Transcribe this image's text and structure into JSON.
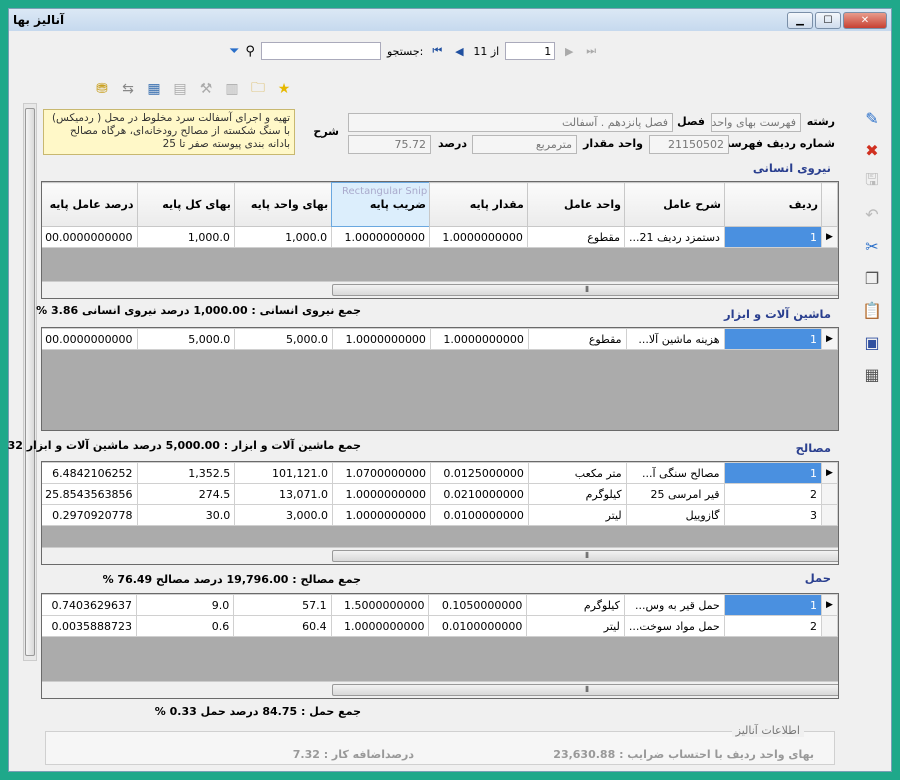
{
  "window": {
    "title": "آنالیز بها"
  },
  "nav": {
    "search_label": "جستجو:",
    "of_label": "از 11",
    "position": "1"
  },
  "header": {
    "reshteh_label": "رشته",
    "reshteh_value": "فهرست بهای واحد پا",
    "fasl_label": "فصل",
    "fasl_value": "فصل پانزدهم . آسفالت",
    "radif_label": "شماره ردیف فهرست",
    "radif_value": "21150502",
    "unit_label": "واحد مقدار",
    "unit_value": "مترمربع",
    "percent_label": "درصد",
    "percent_value": "75.72",
    "sharh_label": "شرح",
    "sharh_value": "تهیه و اجرای آسفالت سرد مخلوط در محل ( ردمیکس) با سنگ شکسته از مصالح رودخانه‌ای، هرگاه مصالح بادانه بندی پیوسته صفر تا 25"
  },
  "columns": [
    "ردیف",
    "شرح عامل",
    "واحد عامل",
    "مقدار پایه",
    "ضریب پایه",
    "بهای واحد پایه",
    "بهای کل پایه",
    "درصد عامل پایه"
  ],
  "sections": [
    {
      "title": "نیروی انسانی",
      "rows": [
        [
          "1",
          "دستمزد ردیف 21...",
          "مقطوع",
          "1.0000000000",
          "1.0000000000",
          "1,000.0",
          "1,000.0",
          "00.0000000000"
        ]
      ],
      "total": "جمع نیروی انسانی : 1,000.00  درصد نیروی انسانی 3.86 %"
    },
    {
      "title": "ماشین آلات و ابزار",
      "rows": [
        [
          "1",
          "هزینه ماشین آلا...",
          "مقطوع",
          "1.0000000000",
          "1.0000000000",
          "5,000.0",
          "5,000.0",
          "00.0000000000"
        ]
      ],
      "total": "جمع ماشین آلات و ابزار : 5,000.00  درصد ماشین آلات و ابزار 32"
    },
    {
      "title": "مصالح",
      "rows": [
        [
          "1",
          "مصالح سنگی آ...",
          "متر مکعب",
          "0.0125000000",
          "1.0700000000",
          "101,121.0",
          "1,352.5",
          "6.4842106252"
        ],
        [
          "2",
          "قیر امرسی 25",
          "کیلوگرم",
          "0.0210000000",
          "1.0000000000",
          "13,071.0",
          "274.5",
          "25.8543563856"
        ],
        [
          "3",
          "گازوییل",
          "لیتر",
          "0.0100000000",
          "1.0000000000",
          "3,000.0",
          "30.0",
          "0.2970920778"
        ]
      ],
      "total": "جمع  مصالح : 19,796.00  درصد  مصالح 76.49 %"
    },
    {
      "title": "حمل",
      "rows": [
        [
          "1",
          "حمل قیر به وس...",
          "کیلوگرم",
          "0.1050000000",
          "1.5000000000",
          "57.1",
          "9.0",
          "0.7403629637"
        ],
        [
          "2",
          "حمل مواد سوخت...",
          "لیتر",
          "0.0100000000",
          "1.0000000000",
          "60.4",
          "0.6",
          "0.0035888723"
        ]
      ],
      "total": "جمع حمل : 84.75  درصد حمل 0.33 %"
    }
  ],
  "info": {
    "title": "اطلاعات آنالیز",
    "unit_price": "بهای واحد ردیف با احتساب ضرایب : 23,630.88",
    "extra_percent": "درصداضافه کار : 7.32"
  },
  "watermark": "Rectangular Snip"
}
